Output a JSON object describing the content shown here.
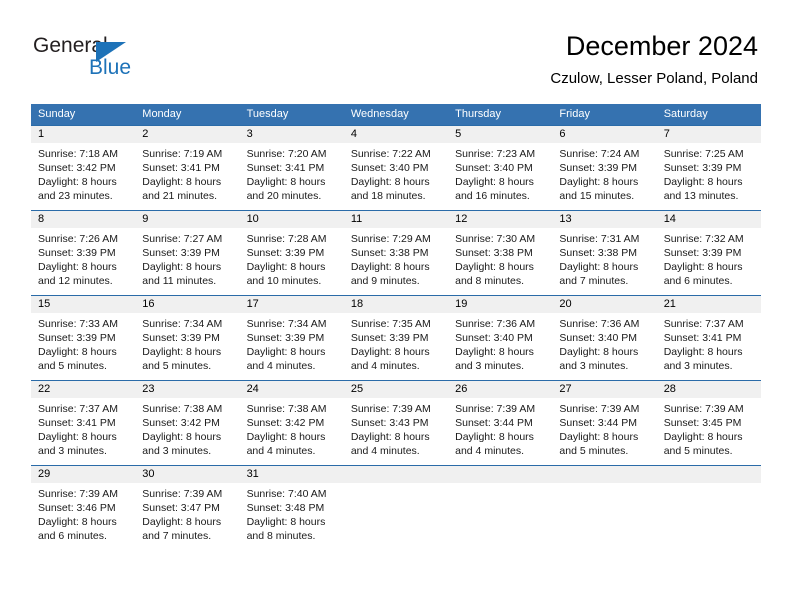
{
  "brand": {
    "name_part1": "General",
    "name_part2": "Blue",
    "accent_color": "#1d72b8"
  },
  "header": {
    "title": "December 2024",
    "subtitle": "Czulow, Lesser Poland, Poland"
  },
  "calendar": {
    "header_color": "#3572b0",
    "daynum_band_color": "#f0f0f0",
    "weekday_labels": [
      "Sunday",
      "Monday",
      "Tuesday",
      "Wednesday",
      "Thursday",
      "Friday",
      "Saturday"
    ],
    "weeks": [
      [
        {
          "day": "1",
          "sunrise": "Sunrise: 7:18 AM",
          "sunset": "Sunset: 3:42 PM",
          "daylight1": "Daylight: 8 hours",
          "daylight2": "and 23 minutes."
        },
        {
          "day": "2",
          "sunrise": "Sunrise: 7:19 AM",
          "sunset": "Sunset: 3:41 PM",
          "daylight1": "Daylight: 8 hours",
          "daylight2": "and 21 minutes."
        },
        {
          "day": "3",
          "sunrise": "Sunrise: 7:20 AM",
          "sunset": "Sunset: 3:41 PM",
          "daylight1": "Daylight: 8 hours",
          "daylight2": "and 20 minutes."
        },
        {
          "day": "4",
          "sunrise": "Sunrise: 7:22 AM",
          "sunset": "Sunset: 3:40 PM",
          "daylight1": "Daylight: 8 hours",
          "daylight2": "and 18 minutes."
        },
        {
          "day": "5",
          "sunrise": "Sunrise: 7:23 AM",
          "sunset": "Sunset: 3:40 PM",
          "daylight1": "Daylight: 8 hours",
          "daylight2": "and 16 minutes."
        },
        {
          "day": "6",
          "sunrise": "Sunrise: 7:24 AM",
          "sunset": "Sunset: 3:39 PM",
          "daylight1": "Daylight: 8 hours",
          "daylight2": "and 15 minutes."
        },
        {
          "day": "7",
          "sunrise": "Sunrise: 7:25 AM",
          "sunset": "Sunset: 3:39 PM",
          "daylight1": "Daylight: 8 hours",
          "daylight2": "and 13 minutes."
        }
      ],
      [
        {
          "day": "8",
          "sunrise": "Sunrise: 7:26 AM",
          "sunset": "Sunset: 3:39 PM",
          "daylight1": "Daylight: 8 hours",
          "daylight2": "and 12 minutes."
        },
        {
          "day": "9",
          "sunrise": "Sunrise: 7:27 AM",
          "sunset": "Sunset: 3:39 PM",
          "daylight1": "Daylight: 8 hours",
          "daylight2": "and 11 minutes."
        },
        {
          "day": "10",
          "sunrise": "Sunrise: 7:28 AM",
          "sunset": "Sunset: 3:39 PM",
          "daylight1": "Daylight: 8 hours",
          "daylight2": "and 10 minutes."
        },
        {
          "day": "11",
          "sunrise": "Sunrise: 7:29 AM",
          "sunset": "Sunset: 3:38 PM",
          "daylight1": "Daylight: 8 hours",
          "daylight2": "and 9 minutes."
        },
        {
          "day": "12",
          "sunrise": "Sunrise: 7:30 AM",
          "sunset": "Sunset: 3:38 PM",
          "daylight1": "Daylight: 8 hours",
          "daylight2": "and 8 minutes."
        },
        {
          "day": "13",
          "sunrise": "Sunrise: 7:31 AM",
          "sunset": "Sunset: 3:38 PM",
          "daylight1": "Daylight: 8 hours",
          "daylight2": "and 7 minutes."
        },
        {
          "day": "14",
          "sunrise": "Sunrise: 7:32 AM",
          "sunset": "Sunset: 3:39 PM",
          "daylight1": "Daylight: 8 hours",
          "daylight2": "and 6 minutes."
        }
      ],
      [
        {
          "day": "15",
          "sunrise": "Sunrise: 7:33 AM",
          "sunset": "Sunset: 3:39 PM",
          "daylight1": "Daylight: 8 hours",
          "daylight2": "and 5 minutes."
        },
        {
          "day": "16",
          "sunrise": "Sunrise: 7:34 AM",
          "sunset": "Sunset: 3:39 PM",
          "daylight1": "Daylight: 8 hours",
          "daylight2": "and 5 minutes."
        },
        {
          "day": "17",
          "sunrise": "Sunrise: 7:34 AM",
          "sunset": "Sunset: 3:39 PM",
          "daylight1": "Daylight: 8 hours",
          "daylight2": "and 4 minutes."
        },
        {
          "day": "18",
          "sunrise": "Sunrise: 7:35 AM",
          "sunset": "Sunset: 3:39 PM",
          "daylight1": "Daylight: 8 hours",
          "daylight2": "and 4 minutes."
        },
        {
          "day": "19",
          "sunrise": "Sunrise: 7:36 AM",
          "sunset": "Sunset: 3:40 PM",
          "daylight1": "Daylight: 8 hours",
          "daylight2": "and 3 minutes."
        },
        {
          "day": "20",
          "sunrise": "Sunrise: 7:36 AM",
          "sunset": "Sunset: 3:40 PM",
          "daylight1": "Daylight: 8 hours",
          "daylight2": "and 3 minutes."
        },
        {
          "day": "21",
          "sunrise": "Sunrise: 7:37 AM",
          "sunset": "Sunset: 3:41 PM",
          "daylight1": "Daylight: 8 hours",
          "daylight2": "and 3 minutes."
        }
      ],
      [
        {
          "day": "22",
          "sunrise": "Sunrise: 7:37 AM",
          "sunset": "Sunset: 3:41 PM",
          "daylight1": "Daylight: 8 hours",
          "daylight2": "and 3 minutes."
        },
        {
          "day": "23",
          "sunrise": "Sunrise: 7:38 AM",
          "sunset": "Sunset: 3:42 PM",
          "daylight1": "Daylight: 8 hours",
          "daylight2": "and 3 minutes."
        },
        {
          "day": "24",
          "sunrise": "Sunrise: 7:38 AM",
          "sunset": "Sunset: 3:42 PM",
          "daylight1": "Daylight: 8 hours",
          "daylight2": "and 4 minutes."
        },
        {
          "day": "25",
          "sunrise": "Sunrise: 7:39 AM",
          "sunset": "Sunset: 3:43 PM",
          "daylight1": "Daylight: 8 hours",
          "daylight2": "and 4 minutes."
        },
        {
          "day": "26",
          "sunrise": "Sunrise: 7:39 AM",
          "sunset": "Sunset: 3:44 PM",
          "daylight1": "Daylight: 8 hours",
          "daylight2": "and 4 minutes."
        },
        {
          "day": "27",
          "sunrise": "Sunrise: 7:39 AM",
          "sunset": "Sunset: 3:44 PM",
          "daylight1": "Daylight: 8 hours",
          "daylight2": "and 5 minutes."
        },
        {
          "day": "28",
          "sunrise": "Sunrise: 7:39 AM",
          "sunset": "Sunset: 3:45 PM",
          "daylight1": "Daylight: 8 hours",
          "daylight2": "and 5 minutes."
        }
      ],
      [
        {
          "day": "29",
          "sunrise": "Sunrise: 7:39 AM",
          "sunset": "Sunset: 3:46 PM",
          "daylight1": "Daylight: 8 hours",
          "daylight2": "and 6 minutes."
        },
        {
          "day": "30",
          "sunrise": "Sunrise: 7:39 AM",
          "sunset": "Sunset: 3:47 PM",
          "daylight1": "Daylight: 8 hours",
          "daylight2": "and 7 minutes."
        },
        {
          "day": "31",
          "sunrise": "Sunrise: 7:40 AM",
          "sunset": "Sunset: 3:48 PM",
          "daylight1": "Daylight: 8 hours",
          "daylight2": "and 8 minutes."
        },
        {
          "day": "",
          "sunrise": "",
          "sunset": "",
          "daylight1": "",
          "daylight2": ""
        },
        {
          "day": "",
          "sunrise": "",
          "sunset": "",
          "daylight1": "",
          "daylight2": ""
        },
        {
          "day": "",
          "sunrise": "",
          "sunset": "",
          "daylight1": "",
          "daylight2": ""
        },
        {
          "day": "",
          "sunrise": "",
          "sunset": "",
          "daylight1": "",
          "daylight2": ""
        }
      ]
    ]
  }
}
